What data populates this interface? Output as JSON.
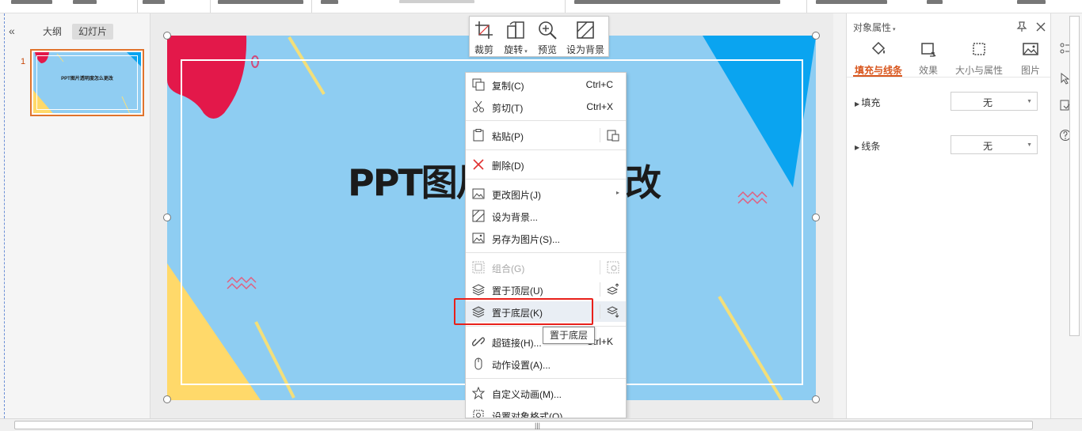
{
  "left_panel": {
    "tabs": [
      {
        "label": "大纲"
      },
      {
        "label": "幻灯片"
      }
    ],
    "collapse_icon": "double-chevron-left-icon",
    "slides": [
      {
        "number": "1",
        "title": "PPT图片透明度怎么更改"
      }
    ]
  },
  "slide": {
    "title": "PPT图片透",
    "title_tail": "改"
  },
  "image_toolbar": {
    "items": [
      {
        "label": "裁剪",
        "icon": "crop-icon"
      },
      {
        "label": "旋转",
        "icon": "rotate-icon"
      },
      {
        "label": "预览",
        "icon": "zoom-icon"
      },
      {
        "label": "设为背景",
        "icon": "set-background-icon"
      }
    ]
  },
  "context_menu": {
    "items": [
      {
        "label": "复制(C)",
        "shortcut": "Ctrl+C",
        "icon": "copy-icon"
      },
      {
        "label": "剪切(T)",
        "shortcut": "Ctrl+X",
        "icon": "cut-icon"
      },
      {
        "label": "粘贴(P)",
        "icon": "paste-icon"
      },
      {
        "label": "删除(D)",
        "icon": "delete-icon"
      },
      {
        "label": "更改图片(J)",
        "icon": "change-picture-icon"
      },
      {
        "label": "设为背景...",
        "icon": "set-background-icon"
      },
      {
        "label": "另存为图片(S)...",
        "icon": "save-as-picture-icon"
      },
      {
        "label": "组合(G)",
        "icon": "group-icon",
        "disabled": true
      },
      {
        "label": "置于顶层(U)",
        "icon": "bring-to-front-icon"
      },
      {
        "label": "置于底层(K)",
        "icon": "send-to-back-icon"
      },
      {
        "label": "超链接(H)...",
        "shortcut": "Ctrl+K",
        "icon": "hyperlink-icon"
      },
      {
        "label": "动作设置(A)...",
        "icon": "mouse-icon"
      },
      {
        "label": "自定义动画(M)...",
        "icon": "star-icon"
      },
      {
        "label": "设置对象格式(O)...",
        "icon": "format-icon"
      }
    ]
  },
  "tooltip": {
    "text": "置于底层"
  },
  "properties": {
    "title": "对象属性",
    "tabs": [
      {
        "label": "填充与线条",
        "icon": "fill-bucket-icon",
        "active": true
      },
      {
        "label": "效果",
        "icon": "effect-icon"
      },
      {
        "label": "大小与属性",
        "icon": "size-icon"
      },
      {
        "label": "图片",
        "icon": "picture-icon"
      }
    ],
    "fill": {
      "label": "填充",
      "value": "无"
    },
    "line": {
      "label": "线条",
      "value": "无"
    }
  },
  "colors": {
    "accent": "#d8541b",
    "highlight_box": "#e8201a",
    "slide_bg": "#8ecdf2"
  }
}
